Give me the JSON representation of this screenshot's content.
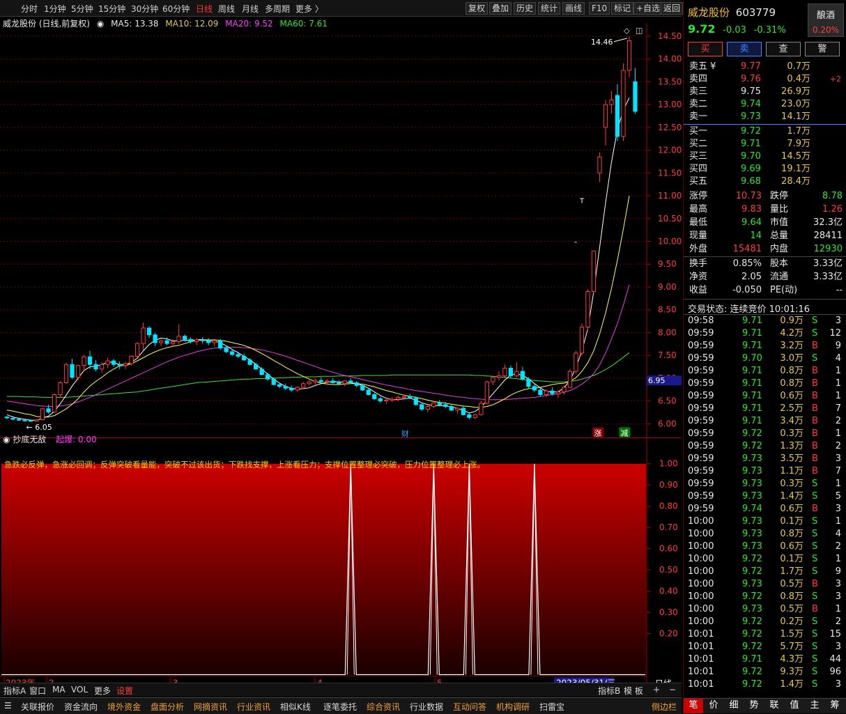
{
  "topbar": {
    "periods": [
      "分时",
      "1分钟",
      "5分钟",
      "15分钟",
      "30分钟",
      "60分钟",
      "日线",
      "周线",
      "月线",
      "多周期",
      "更多 〉"
    ],
    "active": "日线",
    "tools": [
      "复权",
      "叠加",
      "历史",
      "统计",
      "画线",
      "F10",
      "标记",
      "+自选",
      "返回"
    ]
  },
  "kline": {
    "title": "威龙股份 (日线,前复权)",
    "ma5": "MA5: 13.38",
    "ma10": "MA10: 12.09",
    "ma20": "MA20: 9.52",
    "ma60": "MA60: 7.61",
    "high_label": "14.46",
    "low_label": "6.05",
    "price_marker": "6.95",
    "tag_cai": "财",
    "tag_zhang": "涨",
    "tag_jian": "减",
    "mark_t": "T",
    "mark_dash": "–",
    "yticks": [
      "14.50",
      "14.00",
      "13.50",
      "13.00",
      "12.50",
      "12.00",
      "11.50",
      "11.00",
      "10.50",
      "10.00",
      "9.50",
      "9.00",
      "8.50",
      "8.00",
      "7.50",
      "7.00",
      "6.50",
      "6.00"
    ]
  },
  "indicator": {
    "name": "抄底无敌",
    "value_label": "起爆: 0.00",
    "message": "急跌必反弹，急涨必回调；反弹突破看量能，突破不过该出货；下跌找支撑，上涨看压力；支撑位置整理必突破，压力位置整理必上涨。",
    "yticks": [
      "1.00",
      "0.90",
      "0.80",
      "0.70",
      "0.60",
      "0.50",
      "0.40",
      "0.30",
      "0.20"
    ]
  },
  "xaxis": {
    "labels": [
      "2023年",
      "2",
      "3",
      "4",
      "5"
    ],
    "cursor_date": "2023/05/31/三",
    "period": "日线"
  },
  "subbar": {
    "items": [
      "指标A",
      "窗口",
      "MA",
      "VOL",
      "更多",
      "设置"
    ],
    "right": [
      "指标B",
      "模 板",
      "+",
      "−"
    ]
  },
  "bottombar": {
    "items": [
      "关联报价",
      "资金流向",
      "境外资金",
      "盘面分析",
      "网摘资讯",
      "行业资讯",
      "相似K线",
      "逐笔委托",
      "综合资讯",
      "行业数据",
      "互动问答",
      "机构调研",
      "扫雷宝"
    ],
    "side": "侧边栏"
  },
  "quote": {
    "name": "威龙股份",
    "code": "603779",
    "price": "9.72",
    "change": "-0.03",
    "pct": "-0.31%",
    "industry": "酿酒",
    "industry_pct": "0.20%",
    "buttons": [
      "买",
      "卖",
      "查",
      "警"
    ],
    "asks": [
      {
        "label": "卖五 ¥",
        "price": "9.77",
        "vol": "0.7万",
        "extra": ""
      },
      {
        "label": "卖四",
        "price": "9.76",
        "vol": "0.4万",
        "extra": "+2"
      },
      {
        "label": "卖三",
        "price": "9.75",
        "vol": "26.9万",
        "extra": ""
      },
      {
        "label": "卖二",
        "price": "9.74",
        "vol": "23.0万",
        "extra": ""
      },
      {
        "label": "卖一",
        "price": "9.73",
        "vol": "14.1万",
        "extra": ""
      }
    ],
    "bids": [
      {
        "label": "买一",
        "price": "9.72",
        "vol": "1.7万"
      },
      {
        "label": "买二",
        "price": "9.71",
        "vol": "7.9万"
      },
      {
        "label": "买三",
        "price": "9.70",
        "vol": "14.5万"
      },
      {
        "label": "买四",
        "price": "9.69",
        "vol": "19.1万"
      },
      {
        "label": "买五",
        "price": "9.68",
        "vol": "28.4万"
      }
    ],
    "stats1": [
      [
        "涨停",
        "10.73",
        "跌停",
        "8.78"
      ],
      [
        "最高",
        "9.83",
        "量比",
        "1.26"
      ],
      [
        "最低",
        "9.64",
        "市值",
        "32.3亿"
      ],
      [
        "现量",
        "14",
        "总量",
        "28411"
      ],
      [
        "外盘",
        "15481",
        "内盘",
        "12930"
      ]
    ],
    "stats2": [
      [
        "换手",
        "0.85%",
        "股本",
        "3.33亿"
      ],
      [
        "净资",
        "2.05",
        "流通",
        "3.33亿"
      ],
      [
        "收益",
        "-0.050",
        "PE(动)",
        "--"
      ]
    ],
    "status": "交易状态: 连续竞价 10:01:16",
    "ticks": [
      [
        "09:58",
        "9.71",
        "0.9万",
        "S",
        "3"
      ],
      [
        "09:59",
        "9.71",
        "4.2万",
        "S",
        "12"
      ],
      [
        "09:59",
        "9.71",
        "3.2万",
        "B",
        "9"
      ],
      [
        "09:59",
        "9.70",
        "3.0万",
        "S",
        "4"
      ],
      [
        "09:59",
        "9.71",
        "0.8万",
        "B",
        "1"
      ],
      [
        "09:59",
        "9.71",
        "0.8万",
        "B",
        "1"
      ],
      [
        "09:59",
        "9.71",
        "0.6万",
        "B",
        "1"
      ],
      [
        "09:59",
        "9.71",
        "2.5万",
        "B",
        "7"
      ],
      [
        "09:59",
        "9.71",
        "3.4万",
        "B",
        "2"
      ],
      [
        "09:59",
        "9.72",
        "0.3万",
        "B",
        "1"
      ],
      [
        "09:59",
        "9.72",
        "1.3万",
        "B",
        "2"
      ],
      [
        "09:59",
        "9.73",
        "3.5万",
        "B",
        "3"
      ],
      [
        "09:59",
        "9.73",
        "1.1万",
        "B",
        "7"
      ],
      [
        "09:59",
        "9.73",
        "0.3万",
        "S",
        "1"
      ],
      [
        "09:59",
        "9.73",
        "1.4万",
        "S",
        "5"
      ],
      [
        "09:59",
        "9.74",
        "0.6万",
        "B",
        "3"
      ],
      [
        "10:00",
        "9.73",
        "0.1万",
        "S",
        "1"
      ],
      [
        "10:00",
        "9.73",
        "0.8万",
        "S",
        "4"
      ],
      [
        "10:00",
        "9.73",
        "0.6万",
        "S",
        "2"
      ],
      [
        "10:00",
        "9.72",
        "0.1万",
        "S",
        "1"
      ],
      [
        "10:00",
        "9.72",
        "1.7万",
        "S",
        "9"
      ],
      [
        "10:00",
        "9.73",
        "0.5万",
        "B",
        "3"
      ],
      [
        "10:00",
        "9.72",
        "0.8万",
        "S",
        "3"
      ],
      [
        "10:00",
        "9.73",
        "0.5万",
        "B",
        "1"
      ],
      [
        "10:00",
        "9.72",
        "0.2万",
        "S",
        "2"
      ],
      [
        "10:01",
        "9.72",
        "1.5万",
        "S",
        "15"
      ],
      [
        "10:01",
        "9.72",
        "5.7万",
        "S",
        "3"
      ],
      [
        "10:01",
        "9.71",
        "4.3万",
        "S",
        "44"
      ],
      [
        "10:01",
        "9.72",
        "9.3万",
        "S",
        "96"
      ],
      [
        "10:01",
        "9.72",
        "1.4万",
        "S",
        "3"
      ]
    ],
    "tabs": [
      "笔",
      "价",
      "细",
      "势",
      "联",
      "值",
      "主",
      "筹"
    ]
  },
  "colors": {
    "up": "#ff3c3c",
    "down": "#2ee62e",
    "candle_down": "#00e5ff",
    "ma5": "#ffffff",
    "ma10": "#ffff4a",
    "ma20": "#e040e0",
    "ma60": "#40e040"
  },
  "chart_data": {
    "type": "candlestick",
    "prev_close": 9.75,
    "candles": [
      [
        6.15,
        6.17,
        6.1,
        6.13
      ],
      [
        6.12,
        6.14,
        6.08,
        6.1
      ],
      [
        6.1,
        6.12,
        6.06,
        6.08
      ],
      [
        6.08,
        6.1,
        6.05,
        6.07
      ],
      [
        6.07,
        6.1,
        6.05,
        6.06
      ],
      [
        6.06,
        6.1,
        6.05,
        6.09
      ],
      [
        6.09,
        6.35,
        6.08,
        6.33
      ],
      [
        6.33,
        6.42,
        6.22,
        6.26
      ],
      [
        6.26,
        6.67,
        6.24,
        6.64
      ],
      [
        6.64,
        6.93,
        6.57,
        6.9
      ],
      [
        6.9,
        7.34,
        6.88,
        7.3
      ],
      [
        7.3,
        7.43,
        6.98,
        7.02
      ],
      [
        7.02,
        7.3,
        6.95,
        7.28
      ],
      [
        7.28,
        7.51,
        7.15,
        7.47
      ],
      [
        7.47,
        7.6,
        7.2,
        7.3
      ],
      [
        7.3,
        7.4,
        7.15,
        7.2
      ],
      [
        7.2,
        7.35,
        7.12,
        7.3
      ],
      [
        7.3,
        7.45,
        7.22,
        7.38
      ],
      [
        7.38,
        7.42,
        7.25,
        7.3
      ],
      [
        7.3,
        7.37,
        7.2,
        7.28
      ],
      [
        7.28,
        7.35,
        7.2,
        7.32
      ],
      [
        7.32,
        7.5,
        7.28,
        7.48
      ],
      [
        7.48,
        7.8,
        7.45,
        7.76
      ],
      [
        7.76,
        8.22,
        7.62,
        8.1
      ],
      [
        8.1,
        8.14,
        7.88,
        7.95
      ],
      [
        7.95,
        8.0,
        7.7,
        7.78
      ],
      [
        7.78,
        7.86,
        7.7,
        7.82
      ],
      [
        7.82,
        7.9,
        7.72,
        7.76
      ],
      [
        7.76,
        7.85,
        7.68,
        7.8
      ],
      [
        7.8,
        8.18,
        7.75,
        7.92
      ],
      [
        7.92,
        7.96,
        7.8,
        7.85
      ],
      [
        7.85,
        7.9,
        7.76,
        7.8
      ],
      [
        7.8,
        7.88,
        7.72,
        7.84
      ],
      [
        7.84,
        7.9,
        7.76,
        7.82
      ],
      [
        7.82,
        7.88,
        7.72,
        7.78
      ],
      [
        7.78,
        7.84,
        7.7,
        7.82
      ],
      [
        7.82,
        7.86,
        7.62,
        7.66
      ],
      [
        7.66,
        7.72,
        7.55,
        7.58
      ],
      [
        7.58,
        7.64,
        7.48,
        7.52
      ],
      [
        7.52,
        7.58,
        7.44,
        7.48
      ],
      [
        7.48,
        7.54,
        7.38,
        7.4
      ],
      [
        7.4,
        7.44,
        7.28,
        7.3
      ],
      [
        7.3,
        7.34,
        7.18,
        7.2
      ],
      [
        7.2,
        7.24,
        7.06,
        7.08
      ],
      [
        7.08,
        7.12,
        6.95,
        6.98
      ],
      [
        6.98,
        7.02,
        6.84,
        6.86
      ],
      [
        6.86,
        6.9,
        6.78,
        6.82
      ],
      [
        6.82,
        6.88,
        6.74,
        6.78
      ],
      [
        6.78,
        6.84,
        6.7,
        6.74
      ],
      [
        6.74,
        6.82,
        6.7,
        6.8
      ],
      [
        6.8,
        6.92,
        6.76,
        6.88
      ],
      [
        6.88,
        6.96,
        6.84,
        6.92
      ],
      [
        6.92,
        7.0,
        6.86,
        6.95
      ],
      [
        6.95,
        7.02,
        6.88,
        6.92
      ],
      [
        6.92,
        6.98,
        6.86,
        6.94
      ],
      [
        6.94,
        7.0,
        6.88,
        6.9
      ],
      [
        6.9,
        6.96,
        6.84,
        6.88
      ],
      [
        6.88,
        6.96,
        6.82,
        6.94
      ],
      [
        6.94,
        7.0,
        6.88,
        6.9
      ],
      [
        6.9,
        6.94,
        6.8,
        6.84
      ],
      [
        6.84,
        6.88,
        6.72,
        6.74
      ],
      [
        6.74,
        6.78,
        6.62,
        6.64
      ],
      [
        6.64,
        6.68,
        6.52,
        6.55
      ],
      [
        6.55,
        6.6,
        6.46,
        6.5
      ],
      [
        6.5,
        6.56,
        6.44,
        6.52
      ],
      [
        6.52,
        6.58,
        6.48,
        6.54
      ],
      [
        6.54,
        6.62,
        6.5,
        6.58
      ],
      [
        6.58,
        6.64,
        6.52,
        6.6
      ],
      [
        6.6,
        6.66,
        6.54,
        6.56
      ],
      [
        6.56,
        6.6,
        6.4,
        6.42
      ],
      [
        6.42,
        6.46,
        6.28,
        6.32
      ],
      [
        6.32,
        6.42,
        6.26,
        6.38
      ],
      [
        6.38,
        6.5,
        6.34,
        6.46
      ],
      [
        6.46,
        6.52,
        6.38,
        6.42
      ],
      [
        6.42,
        6.48,
        6.34,
        6.38
      ],
      [
        6.38,
        6.42,
        6.28,
        6.3
      ],
      [
        6.3,
        6.36,
        6.22,
        6.34
      ],
      [
        6.34,
        6.38,
        6.18,
        6.2
      ],
      [
        6.2,
        6.24,
        6.1,
        6.14
      ],
      [
        6.14,
        6.22,
        6.1,
        6.2
      ],
      [
        6.2,
        6.5,
        6.18,
        6.45
      ],
      [
        6.45,
        6.95,
        6.42,
        6.92
      ],
      [
        6.92,
        7.05,
        6.85,
        7.02
      ],
      [
        7.02,
        7.15,
        6.95,
        7.05
      ],
      [
        7.05,
        7.3,
        7.0,
        7.22
      ],
      [
        7.22,
        7.28,
        7.0,
        7.05
      ],
      [
        7.05,
        7.35,
        7.02,
        7.15
      ],
      [
        7.15,
        7.25,
        6.95,
        6.98
      ],
      [
        6.98,
        7.02,
        6.78,
        6.82
      ],
      [
        6.82,
        6.86,
        6.7,
        6.74
      ],
      [
        6.74,
        6.78,
        6.6,
        6.64
      ],
      [
        6.64,
        6.76,
        6.58,
        6.72
      ],
      [
        6.72,
        6.8,
        6.62,
        6.66
      ],
      [
        6.66,
        6.74,
        6.56,
        6.7
      ],
      [
        6.7,
        6.84,
        6.64,
        6.8
      ],
      [
        6.8,
        7.2,
        6.78,
        7.15
      ],
      [
        7.15,
        7.6,
        7.1,
        7.55
      ],
      [
        7.55,
        8.2,
        7.5,
        8.12
      ],
      [
        8.12,
        8.95,
        8.05,
        8.9
      ],
      [
        8.9,
        9.8,
        8.85,
        9.79
      ],
      [
        11.5,
        11.95,
        11.3,
        11.85
      ],
      [
        12.5,
        13.1,
        12.1,
        13.0
      ],
      [
        13.0,
        13.3,
        12.8,
        13.1
      ],
      [
        13.2,
        13.45,
        12.2,
        12.3
      ],
      [
        12.3,
        13.9,
        12.2,
        13.75
      ],
      [
        13.75,
        14.5,
        13.6,
        14.4
      ],
      [
        13.5,
        13.8,
        12.8,
        12.85
      ]
    ],
    "ma5": [
      6.2,
      6.15,
      6.12,
      6.1,
      6.08,
      6.08,
      6.12,
      6.17,
      6.27,
      6.44,
      6.63,
      6.83,
      7.0,
      7.17,
      7.25,
      7.26,
      7.3,
      7.35,
      7.35,
      7.3,
      7.3,
      7.35,
      7.44,
      7.6,
      7.74,
      7.83,
      7.88,
      7.86,
      7.82,
      7.82,
      7.83,
      7.83,
      7.84,
      7.85,
      7.82,
      7.81,
      7.78,
      7.71,
      7.63,
      7.56,
      7.48,
      7.4,
      7.3,
      7.2,
      7.09,
      6.98,
      6.89,
      6.82,
      6.78,
      6.76,
      6.77,
      6.79,
      6.84,
      6.88,
      6.91,
      6.93,
      6.92,
      6.91,
      6.9,
      6.88,
      6.84,
      6.78,
      6.7,
      6.62,
      6.56,
      6.53,
      6.53,
      6.55,
      6.56,
      6.52,
      6.46,
      6.42,
      6.4,
      6.4,
      6.4,
      6.37,
      6.34,
      6.29,
      6.24,
      6.27,
      6.37,
      6.51,
      6.66,
      6.81,
      6.96,
      7.07,
      7.1,
      7.06,
      6.99,
      6.88,
      6.79,
      6.71,
      6.7,
      6.7,
      6.79,
      6.95,
      7.23,
      7.6,
      8.08,
      8.9,
      9.87,
      10.85,
      11.74,
      12.45,
      12.88,
      13.15
    ],
    "ma10": [
      6.3,
      6.28,
      6.25,
      6.22,
      6.2,
      6.16,
      6.15,
      6.15,
      6.18,
      6.25,
      6.33,
      6.43,
      6.55,
      6.7,
      6.83,
      6.93,
      7.02,
      7.12,
      7.2,
      7.27,
      7.28,
      7.32,
      7.38,
      7.45,
      7.52,
      7.58,
      7.63,
      7.67,
      7.7,
      7.72,
      7.76,
      7.8,
      7.83,
      7.84,
      7.84,
      7.84,
      7.83,
      7.81,
      7.78,
      7.75,
      7.72,
      7.67,
      7.61,
      7.54,
      7.47,
      7.39,
      7.32,
      7.24,
      7.17,
      7.1,
      7.04,
      6.98,
      6.93,
      6.89,
      6.87,
      6.86,
      6.86,
      6.87,
      6.88,
      6.88,
      6.87,
      6.84,
      6.81,
      6.77,
      6.73,
      6.7,
      6.66,
      6.63,
      6.6,
      6.58,
      6.55,
      6.52,
      6.49,
      6.47,
      6.45,
      6.43,
      6.41,
      6.39,
      6.38,
      6.36,
      6.36,
      6.38,
      6.42,
      6.48,
      6.55,
      6.63,
      6.69,
      6.74,
      6.77,
      6.78,
      6.8,
      6.83,
      6.86,
      6.88,
      6.89,
      6.93,
      7.01,
      7.15,
      7.34,
      7.6,
      7.97,
      8.43,
      8.97,
      9.59,
      10.27,
      11.0
    ],
    "ma20": [
      6.5,
      6.48,
      6.46,
      6.44,
      6.42,
      6.4,
      6.39,
      6.38,
      6.38,
      6.39,
      6.41,
      6.44,
      6.48,
      6.53,
      6.58,
      6.64,
      6.7,
      6.76,
      6.82,
      6.88,
      6.94,
      7.0,
      7.06,
      7.12,
      7.18,
      7.24,
      7.3,
      7.36,
      7.41,
      7.46,
      7.5,
      7.54,
      7.58,
      7.61,
      7.64,
      7.66,
      7.67,
      7.68,
      7.68,
      7.68,
      7.67,
      7.66,
      7.64,
      7.62,
      7.59,
      7.56,
      7.52,
      7.48,
      7.44,
      7.39,
      7.35,
      7.3,
      7.26,
      7.21,
      7.17,
      7.13,
      7.09,
      7.06,
      7.03,
      7.0,
      6.97,
      6.94,
      6.91,
      6.88,
      6.85,
      6.83,
      6.8,
      6.78,
      6.75,
      6.73,
      6.71,
      6.69,
      6.67,
      6.65,
      6.63,
      6.61,
      6.59,
      6.58,
      6.56,
      6.55,
      6.54,
      6.53,
      6.53,
      6.53,
      6.53,
      6.54,
      6.55,
      6.56,
      6.57,
      6.58,
      6.6,
      6.62,
      6.64,
      6.66,
      6.69,
      6.73,
      6.79,
      6.87,
      6.97,
      7.1,
      7.29,
      7.55,
      7.86,
      8.2,
      8.6,
      9.05
    ],
    "ma60": [
      6.6,
      6.6,
      6.6,
      6.59,
      6.59,
      6.59,
      6.58,
      6.58,
      6.58,
      6.58,
      6.58,
      6.59,
      6.6,
      6.61,
      6.62,
      6.63,
      6.64,
      6.65,
      6.66,
      6.67,
      6.68,
      6.69,
      6.7,
      6.72,
      6.74,
      6.76,
      6.78,
      6.8,
      6.82,
      6.84,
      6.86,
      6.88,
      6.9,
      6.91,
      6.92,
      6.93,
      6.94,
      6.95,
      6.96,
      6.97,
      6.98,
      6.98,
      6.99,
      6.99,
      7.0,
      7.0,
      7.01,
      7.01,
      7.02,
      7.02,
      7.03,
      7.03,
      7.03,
      7.04,
      7.04,
      7.04,
      7.05,
      7.05,
      7.05,
      7.05,
      7.06,
      7.06,
      7.06,
      7.06,
      7.06,
      7.07,
      7.07,
      7.07,
      7.07,
      7.07,
      7.07,
      7.07,
      7.07,
      7.07,
      7.07,
      7.07,
      7.07,
      7.07,
      7.07,
      7.06,
      7.06,
      7.05,
      7.04,
      7.03,
      7.02,
      7.0,
      6.99,
      6.97,
      6.96,
      6.95,
      6.94,
      6.93,
      6.92,
      6.92,
      6.92,
      6.93,
      6.95,
      6.98,
      7.02,
      7.06,
      7.12,
      7.19,
      7.27,
      7.36,
      7.46,
      7.56
    ],
    "indicator_spikes": [
      58,
      72,
      78,
      89
    ],
    "y_range": [
      5.8,
      14.75
    ],
    "indicator_range": [
      0,
      1.05
    ]
  }
}
